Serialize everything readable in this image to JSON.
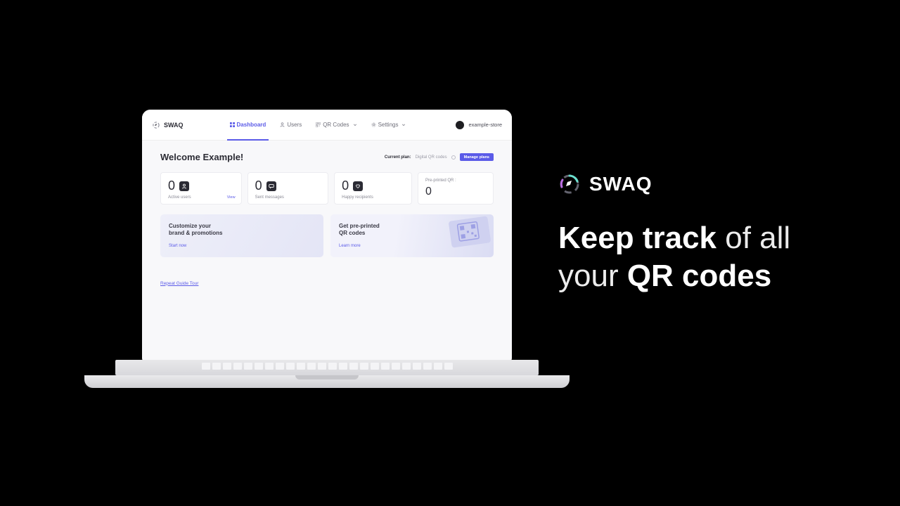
{
  "hero": {
    "brand": "SWAQ",
    "headline_p1": "Keep track",
    "headline_p2": " of all your ",
    "headline_p3": "QR codes"
  },
  "app": {
    "brand": "SWAQ",
    "nav": {
      "dashboard": "Dashboard",
      "users": "Users",
      "qrcodes": "QR Codes",
      "settings": "Settings"
    },
    "account": "example-store",
    "welcome": "Welcome Example!",
    "plan": {
      "label": "Current plan:",
      "name": "Digital QR codes",
      "manage": "Manage plans"
    },
    "stats": {
      "active_users": {
        "value": "0",
        "label": "Active users",
        "view": "View"
      },
      "sent_messages": {
        "value": "0",
        "label": "Sent messages"
      },
      "happy_recipients": {
        "value": "0",
        "label": "Happy recipients"
      },
      "preprinted": {
        "label": "Pre-printed QR :",
        "value": "0"
      }
    },
    "promos": {
      "customize": {
        "title_l1": "Customize your",
        "title_l2": "brand & promotions",
        "cta": "Start now"
      },
      "preprinted": {
        "title_l1": "Get pre-printed",
        "title_l2": "QR codes",
        "cta": "Learn more"
      }
    },
    "guide_link": "Repeat Guide Tour"
  }
}
